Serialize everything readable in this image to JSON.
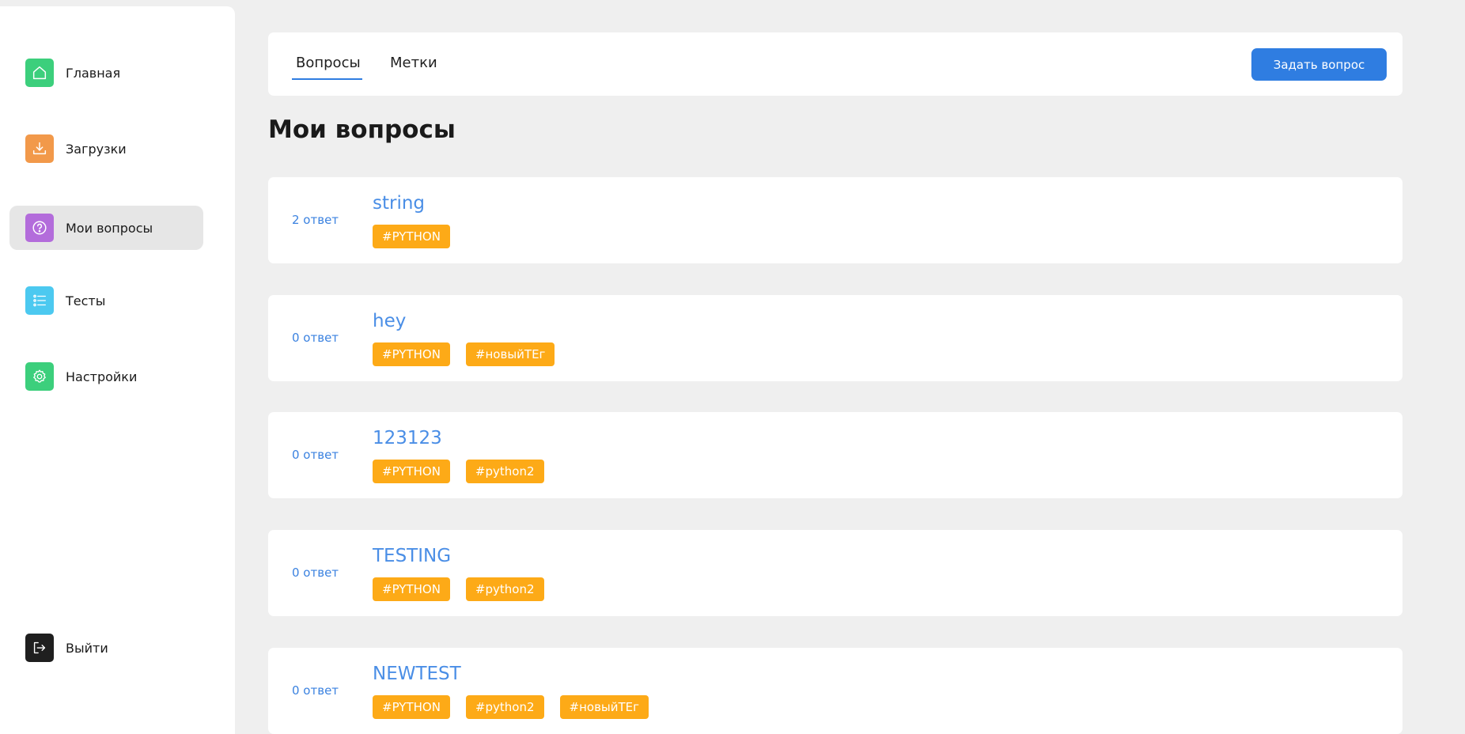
{
  "sidebar": {
    "items": [
      {
        "label": "Главная",
        "icon": "home-icon",
        "color": "#3ccf7c"
      },
      {
        "label": "Загрузки",
        "icon": "download-icon",
        "color": "#f2994a"
      },
      {
        "label": "Мои вопросы",
        "icon": "question-icon",
        "color": "#b36cdb",
        "active": true
      },
      {
        "label": "Тесты",
        "icon": "list-icon",
        "color": "#4cc9f0"
      },
      {
        "label": "Настройки",
        "icon": "gear-icon",
        "color": "#3ccf7c"
      }
    ],
    "logout": {
      "label": "Выйти",
      "icon": "logout-icon",
      "color": "#1f1f1f"
    }
  },
  "header": {
    "tabs": [
      {
        "label": "Вопросы",
        "active": true
      },
      {
        "label": "Метки"
      }
    ],
    "ask_button": "Задать вопрос"
  },
  "main": {
    "title": "Мои вопросы",
    "questions": [
      {
        "answers": "2 ответ",
        "title": "string",
        "tags": [
          "#PYTHON"
        ]
      },
      {
        "answers": "0 ответ",
        "title": "hey",
        "tags": [
          "#PYTHON",
          "#новыйТЕг"
        ]
      },
      {
        "answers": "0 ответ",
        "title": "123123",
        "tags": [
          "#PYTHON",
          "#python2"
        ]
      },
      {
        "answers": "0 ответ",
        "title": "TESTING",
        "tags": [
          "#PYTHON",
          "#python2"
        ]
      },
      {
        "answers": "0 ответ",
        "title": "NEWTEST",
        "tags": [
          "#PYTHON",
          "#python2",
          "#новыйТЕг"
        ]
      }
    ]
  },
  "colors": {
    "accent": "#2f7de1",
    "tag": "#fdaa17",
    "link": "#4a8ee6"
  }
}
